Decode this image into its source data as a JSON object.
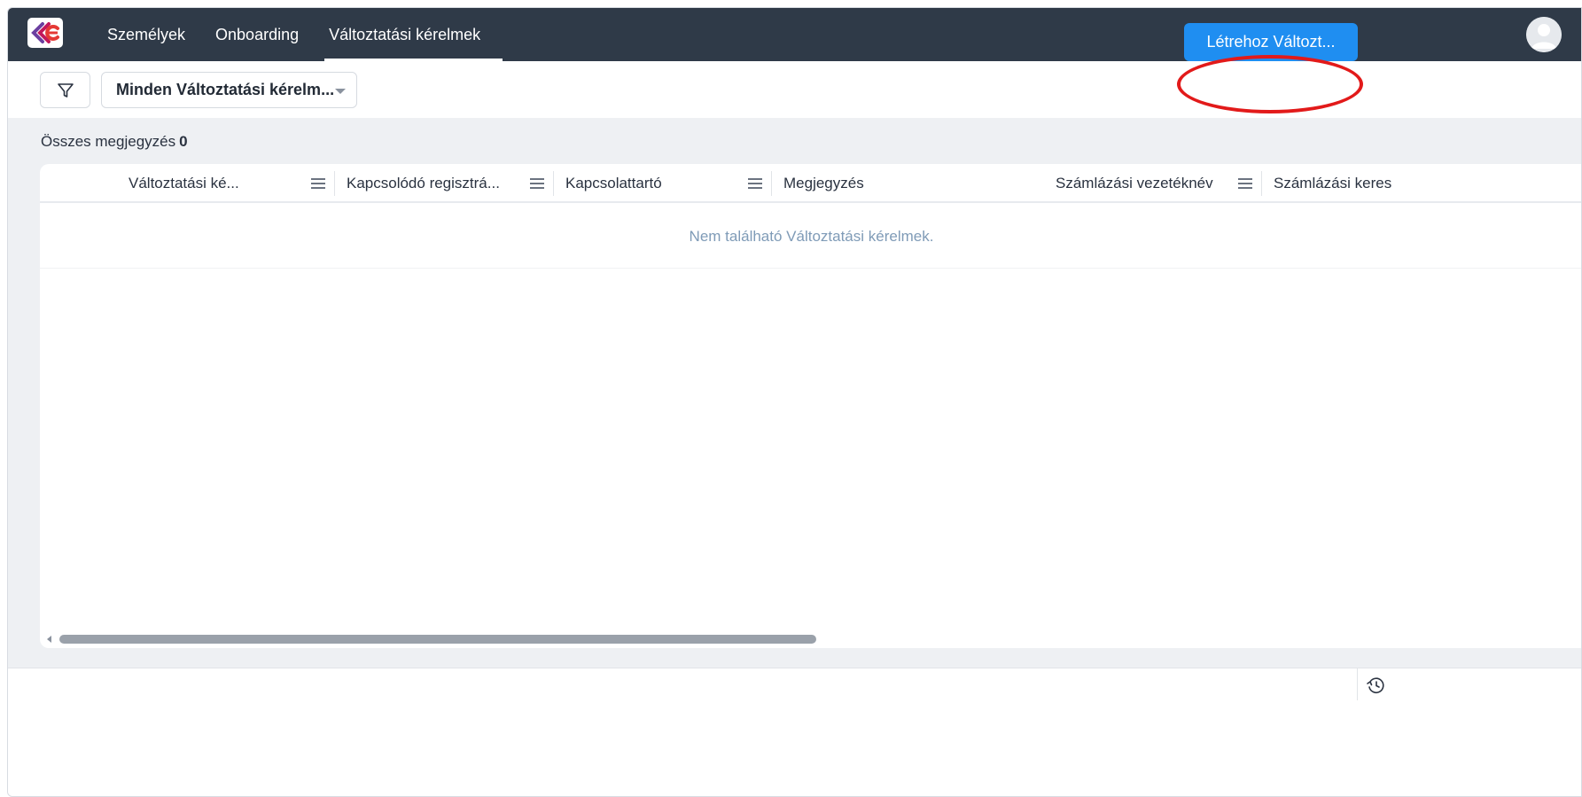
{
  "nav": {
    "items": [
      {
        "label": "Személyek"
      },
      {
        "label": "Onboarding"
      },
      {
        "label": "Változtatási kérelmek",
        "active": true
      }
    ],
    "brand_color": "#2f3a48"
  },
  "toolbar": {
    "filter_icon": "filter-icon",
    "view_select": "Minden Változtatási kérelm...",
    "create_button": "Létrehoz Változt...",
    "accent_color": "#1f8ef1",
    "highlight_color": "#e21a1a"
  },
  "summary": {
    "label": "Összes megjegyzés",
    "count": "0"
  },
  "table": {
    "columns": [
      {
        "label": "Változtatási ké..."
      },
      {
        "label": "Kapcsolódó regisztrá..."
      },
      {
        "label": "Kapcsolattartó"
      },
      {
        "label": "Megjegyzés"
      },
      {
        "label": "Számlázási vezetéknév"
      },
      {
        "label": "Számlázási keres"
      }
    ],
    "empty_message": "Nem található Változtatási kérelmek."
  }
}
